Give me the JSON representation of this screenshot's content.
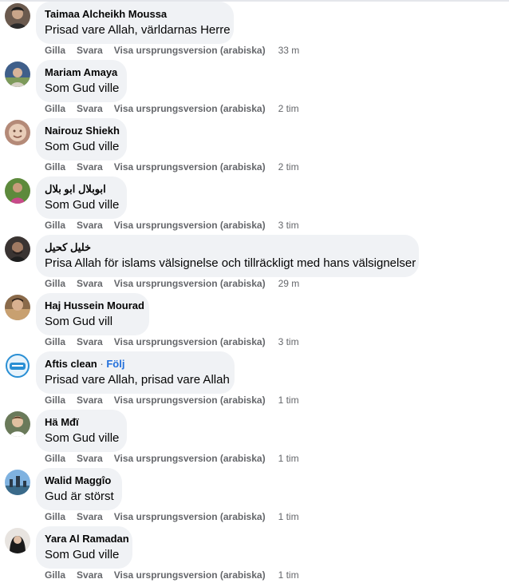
{
  "actions": {
    "like": "Gilla",
    "reply": "Svara",
    "translate": "Visa ursprungsversion (arabiska)"
  },
  "comments": [
    {
      "name": "Taimaa Alcheikh Moussa",
      "text": "Prisad vare Allah, världarnas Herre",
      "time": "33 m"
    },
    {
      "name": "Mariam Amaya",
      "text": "Som Gud ville",
      "time": "2 tim"
    },
    {
      "name": "Nairouz Shiekh",
      "text": "Som Gud ville",
      "time": "2 tim"
    },
    {
      "name": "ابوبلال ابو بلال",
      "text": "Som Gud ville",
      "time": "3 tim"
    },
    {
      "name": "خليل كحيل",
      "text": "Prisa Allah för islams välsignelse och tillräckligt med hans välsignelser",
      "time": "29 m"
    },
    {
      "name": "Haj Hussein Mourad",
      "text": "Som Gud vill",
      "time": "3 tim"
    },
    {
      "name": "Aftis clean",
      "follow_sep": "·",
      "follow": "Följ",
      "text": "Prisad vare Allah, prisad vare Allah",
      "time": "1 tim"
    },
    {
      "name": "Hä Mđï",
      "text": "Som Gud ville",
      "time": "1 tim"
    },
    {
      "name": "Walid Maggîo",
      "text": "Gud är störst",
      "time": "1 tim"
    },
    {
      "name": "Yara Al Ramadan",
      "text": "Som Gud ville",
      "time": "1 tim"
    }
  ]
}
